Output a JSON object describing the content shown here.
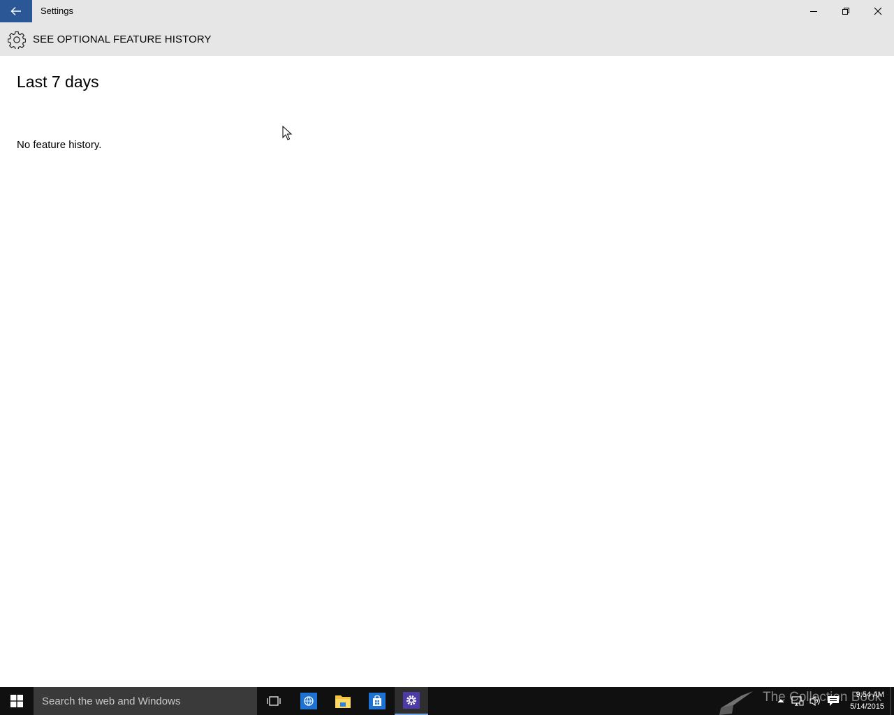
{
  "window": {
    "title": "Settings"
  },
  "header": {
    "title": "SEE OPTIONAL FEATURE HISTORY",
    "icon": "gear-icon"
  },
  "content": {
    "section_title": "Last 7 days",
    "empty_message": "No feature history."
  },
  "taskbar": {
    "search_placeholder": "Search the web and Windows",
    "apps": [
      "task-view",
      "internet-explorer",
      "file-explorer",
      "store",
      "settings"
    ],
    "active_app": "settings",
    "watermark": "The Collection Book",
    "clock": {
      "time": "9:54 AM",
      "date": "5/14/2015"
    }
  },
  "colors": {
    "accent": "#2b5797",
    "titlebar": "#e6e6e6",
    "taskbar": "#101010"
  }
}
